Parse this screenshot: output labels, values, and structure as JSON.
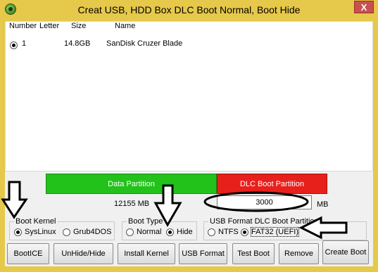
{
  "window": {
    "title": "Creat USB, HDD Box DLC Boot Normal, Boot Hide",
    "close_label": "X"
  },
  "list": {
    "headers": [
      "Number",
      "Letter",
      "Size",
      "Name"
    ],
    "rows": [
      {
        "number": "1",
        "letter": "",
        "size": "14.8GB",
        "name": "SanDisk Cruzer Blade",
        "selected": true
      }
    ]
  },
  "partitions": {
    "data_label": "Data Partition",
    "dlc_label": "DLC Boot Partition",
    "data_size": "12155 MB",
    "dlc_size_value": "3000",
    "dlc_size_unit": "MB",
    "colors": {
      "data": "#22c21a",
      "dlc": "#e8201c"
    }
  },
  "boot_kernel": {
    "title": "Boot Kernel",
    "options": [
      "SysLinux",
      "Grub4DOS"
    ],
    "selected": "SysLinux"
  },
  "boot_type": {
    "title": "Boot Type",
    "options": [
      "Normal",
      "Hide"
    ],
    "selected": "Hide"
  },
  "usb_format": {
    "title": "USB Format DLC Boot Partition",
    "options": [
      "NTFS",
      "FAT32 (UEFI)"
    ],
    "selected": "FAT32 (UEFI)"
  },
  "buttons": {
    "bootice": "BootICE",
    "unhide": "UnHide/Hide",
    "install_kernel": "Install Kernel",
    "usb_format": "USB Format",
    "test_boot": "Test Boot",
    "remove": "Remove",
    "create_boot": "Create Boot"
  }
}
